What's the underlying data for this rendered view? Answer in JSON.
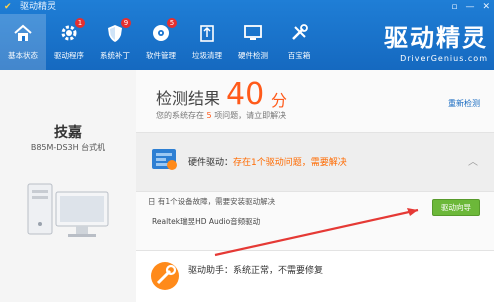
{
  "titlebar": {
    "title": "驱动精灵",
    "window_controls": [
      "▫",
      "—",
      "✕"
    ]
  },
  "nav": {
    "items": [
      {
        "label": "基本状态",
        "icon": "home-icon",
        "active": true
      },
      {
        "label": "驱动程序",
        "icon": "gear-icon",
        "badge": "1"
      },
      {
        "label": "系统补丁",
        "icon": "shield-icon",
        "badge": "9"
      },
      {
        "label": "软件管理",
        "icon": "disc-icon",
        "badge": "5"
      },
      {
        "label": "垃圾清理",
        "icon": "trash-icon"
      },
      {
        "label": "硬件检测",
        "icon": "monitor-icon"
      },
      {
        "label": "百宝箱",
        "icon": "tools-icon"
      }
    ]
  },
  "brand": {
    "cn": "驱动精灵",
    "en": "DriverGenius.com"
  },
  "sidebar": {
    "brand_name": "技嘉",
    "model": "B85M-DS3H 台式机"
  },
  "result": {
    "title": "检测结果",
    "score": "40",
    "score_unit": "分",
    "desc_prefix": "您的系统存在",
    "desc_count": "5",
    "desc_suffix": "项问题，请立即解决",
    "recheck": "重新检测"
  },
  "hardware": {
    "label": "硬件驱动：",
    "status": "存在1个驱动问题，需要解决"
  },
  "problem": {
    "text": "日 有1个设备故障，需要安装驱动解决",
    "driver": "Realtek瑞昱HD Audio音频驱动",
    "button": "驱动向导"
  },
  "helper": {
    "label": "驱动助手：系统正常，不需要修复"
  },
  "colors": {
    "header_blue": "#1a74cf",
    "score_orange": "#ff5a1a",
    "button_green": "#6cb839",
    "arrow_red": "#e53935"
  }
}
